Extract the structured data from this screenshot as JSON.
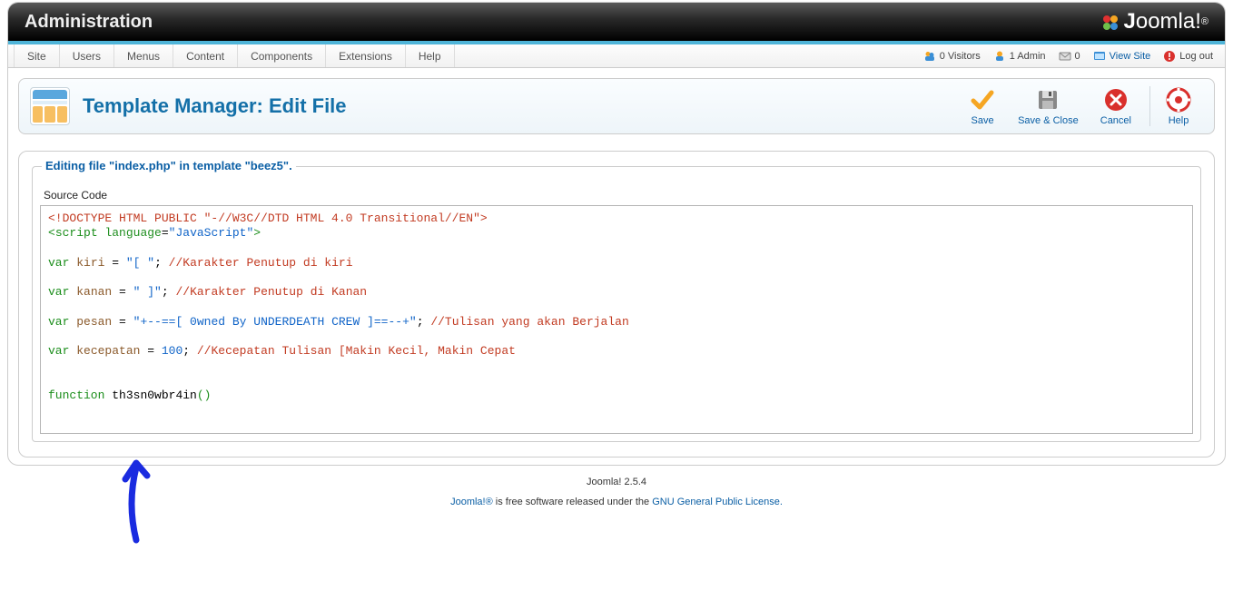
{
  "header": {
    "title": "Administration",
    "brand_first": "J",
    "brand_rest": "oomla!"
  },
  "menu": {
    "items": [
      "Site",
      "Users",
      "Menus",
      "Content",
      "Components",
      "Extensions",
      "Help"
    ]
  },
  "status": {
    "visitors": "0 Visitors",
    "admin": "1 Admin",
    "msgs": "0",
    "view_site": "View Site",
    "logout": "Log out"
  },
  "toolbar": {
    "title": "Template Manager: Edit File",
    "actions": {
      "save": "Save",
      "save_close": "Save & Close",
      "cancel": "Cancel",
      "help": "Help"
    }
  },
  "editor": {
    "legend": "Editing file \"index.php\" in template \"beez5\".",
    "source_label": "Source Code",
    "code": {
      "doctype": "<!DOCTYPE HTML PUBLIC \"-//W3C//DTD HTML 4.0 Transitional//EN\">",
      "script_open_a": "<",
      "script_tag": "script",
      "script_sp": " ",
      "script_attr": "language",
      "script_eq": "=",
      "script_val": "\"JavaScript\"",
      "script_open_b": ">",
      "l1_kw": "var",
      "l1_id": "kiri",
      "l1_eq": " = ",
      "l1_str": "\"[ \"",
      "l1_semi": "; ",
      "l1_cmt": "//Karakter Penutup di kiri",
      "l2_kw": "var",
      "l2_id": "kanan",
      "l2_eq": " = ",
      "l2_str": "\" ]\"",
      "l2_semi": "; ",
      "l2_cmt": "//Karakter Penutup di Kanan",
      "l3_kw": "var",
      "l3_id": "pesan",
      "l3_eq": " = ",
      "l3_str": "\"+--==[ 0wned By UNDERDEATH CREW ]==--+\"",
      "l3_semi": "; ",
      "l3_cmt": "//Tulisan yang akan Berjalan",
      "l4_kw": "var",
      "l4_id": "kecepatan",
      "l4_eq": " = ",
      "l4_num": "100",
      "l4_semi": "; ",
      "l4_cmt": "//Kecepatan Tulisan [Makin Kecil, Makin Cepat",
      "fn_kw": "function",
      "fn_name": "th3sn0wbr4in",
      "fn_paren": "()"
    }
  },
  "footer": {
    "version": "Joomla! 2.5.4",
    "license_a": "Joomla!®",
    "license_b": " is free software released under the ",
    "license_link": "GNU General Public License."
  }
}
